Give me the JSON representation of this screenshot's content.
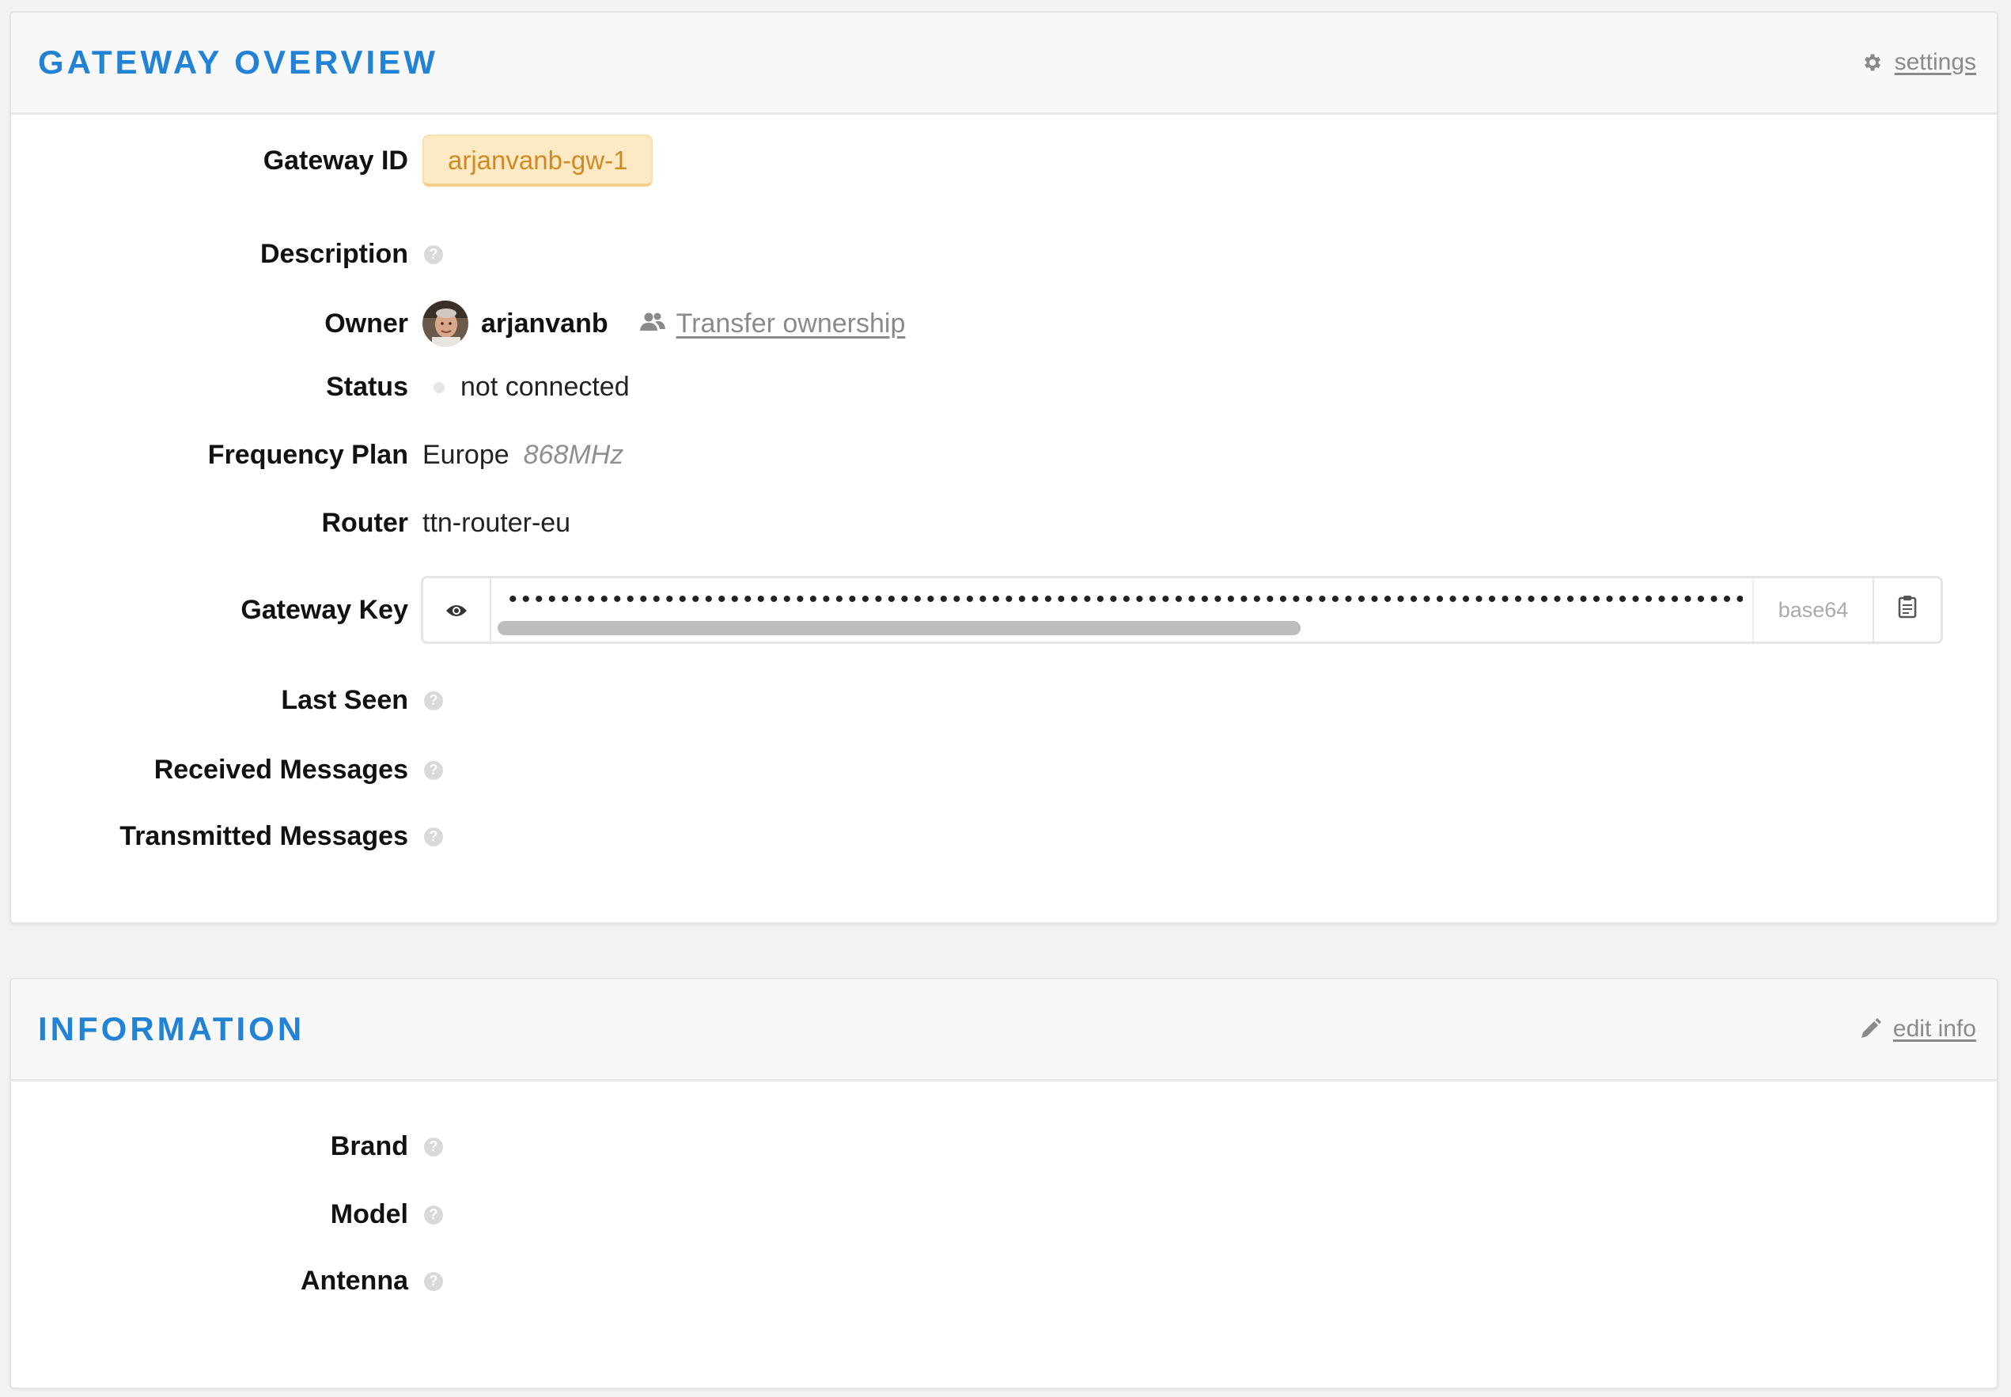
{
  "overview": {
    "title": "GATEWAY OVERVIEW",
    "settings_label": "settings",
    "fields": {
      "gateway_id_label": "Gateway ID",
      "gateway_id_value": "arjanvanb-gw-1",
      "description_label": "Description",
      "owner_label": "Owner",
      "owner_name": "arjanvanb",
      "transfer_label": "Transfer ownership",
      "status_label": "Status",
      "status_value": "not connected",
      "frequency_label": "Frequency Plan",
      "frequency_region": "Europe",
      "frequency_band": "868MHz",
      "router_label": "Router",
      "router_value": "ttn-router-eu",
      "gateway_key_label": "Gateway Key",
      "gateway_key_masked": "••••••••••••••••••••••••••••••••••••••••••••••••••••••••••••••••••••••••••••••••••••••••••••••••••••••••••••••••",
      "gateway_key_format": "base64",
      "gateway_key_scroll_fraction": 0.64,
      "last_seen_label": "Last Seen",
      "received_label": "Received Messages",
      "transmitted_label": "Transmitted Messages"
    },
    "help_glyph": "?"
  },
  "information": {
    "title": "INFORMATION",
    "edit_label": "edit info",
    "fields": {
      "brand_label": "Brand",
      "model_label": "Model",
      "antenna_label": "Antenna"
    }
  },
  "icons": {
    "settings": "gear-icon",
    "edit": "pencil-icon",
    "transfer": "users-icon",
    "reveal": "eye-icon",
    "copy": "clipboard-icon",
    "help": "question-icon"
  },
  "colors": {
    "accent": "#2182d6",
    "badge_bg": "#fde9c4",
    "badge_text": "#d08a24",
    "muted": "#8a8a8a"
  }
}
